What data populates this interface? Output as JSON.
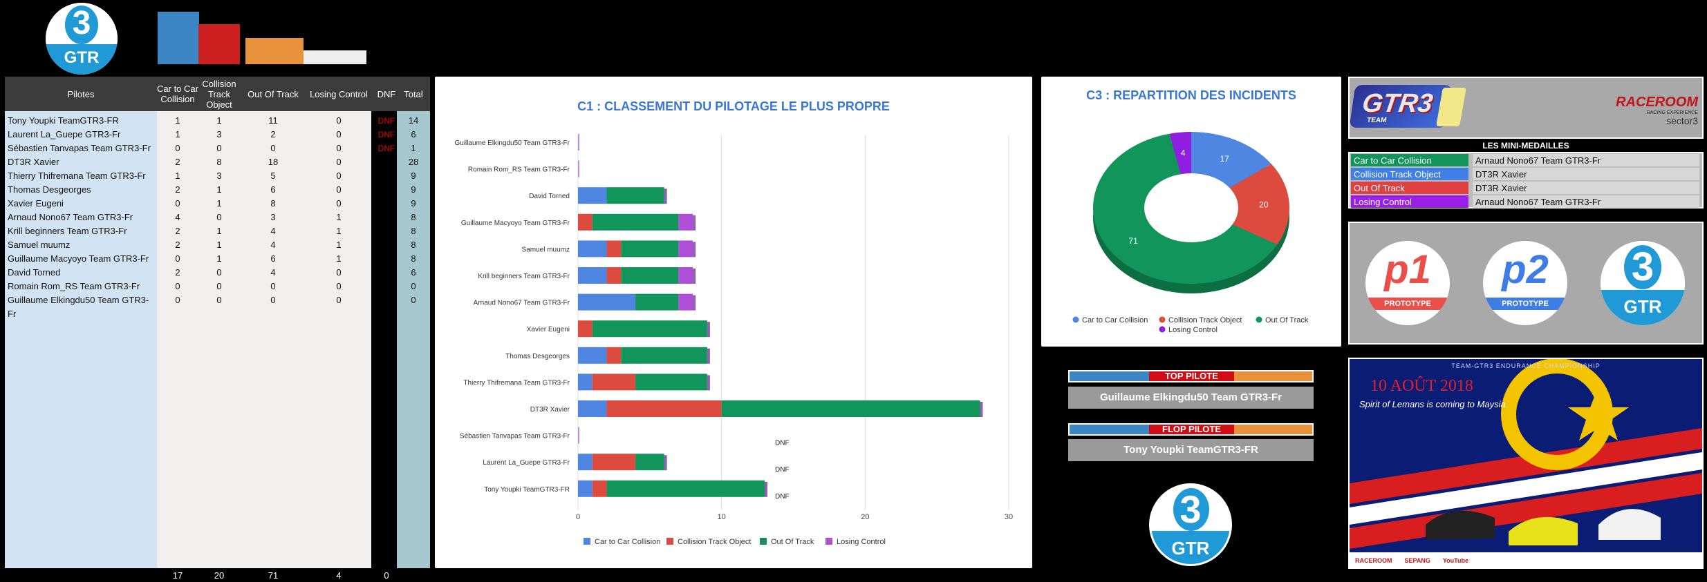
{
  "header": {
    "logo_number": "3",
    "logo_text": "GTR",
    "color_bars": [
      "#3d86c6",
      "#cc1f1f",
      "#e8923c",
      "#efefef"
    ]
  },
  "table": {
    "headers": [
      "Pilotes",
      "Car to Car Collision",
      "Collision Track Object",
      "Out Of Track",
      "Losing Control",
      "DNF",
      "Total"
    ],
    "rows": [
      {
        "name": "Tony Youpki TeamGTR3-FR",
        "c2c": "1",
        "cto": "1",
        "oot": "11",
        "lc": "0",
        "dnf": "DNF",
        "total": "14"
      },
      {
        "name": "Laurent La_Guepe GTR3-Fr",
        "c2c": "1",
        "cto": "3",
        "oot": "2",
        "lc": "0",
        "dnf": "DNF",
        "total": "6"
      },
      {
        "name": "Sébastien Tanvapas Team GTR3-Fr",
        "c2c": "0",
        "cto": "0",
        "oot": "0",
        "lc": "0",
        "dnf": "DNF",
        "total": "1"
      },
      {
        "name": "DT3R Xavier",
        "c2c": "2",
        "cto": "8",
        "oot": "18",
        "lc": "0",
        "dnf": "",
        "total": "28"
      },
      {
        "name": "Thierry Thifremana Team GTR3-Fr",
        "c2c": "1",
        "cto": "3",
        "oot": "5",
        "lc": "0",
        "dnf": "",
        "total": "9"
      },
      {
        "name": "Thomas Desgeorges",
        "c2c": "2",
        "cto": "1",
        "oot": "6",
        "lc": "0",
        "dnf": "",
        "total": "9"
      },
      {
        "name": "Xavier Eugeni",
        "c2c": "0",
        "cto": "1",
        "oot": "8",
        "lc": "0",
        "dnf": "",
        "total": "9"
      },
      {
        "name": "Arnaud Nono67 Team GTR3-Fr",
        "c2c": "4",
        "cto": "0",
        "oot": "3",
        "lc": "1",
        "dnf": "",
        "total": "8"
      },
      {
        "name": "Krill beginners Team GTR3-Fr",
        "c2c": "2",
        "cto": "1",
        "oot": "4",
        "lc": "1",
        "dnf": "",
        "total": "8"
      },
      {
        "name": "Samuel muumz",
        "c2c": "2",
        "cto": "1",
        "oot": "4",
        "lc": "1",
        "dnf": "",
        "total": "8"
      },
      {
        "name": "Guillaume Macyoyo Team GTR3-Fr",
        "c2c": "0",
        "cto": "1",
        "oot": "6",
        "lc": "1",
        "dnf": "",
        "total": "8"
      },
      {
        "name": "David Torned",
        "c2c": "2",
        "cto": "0",
        "oot": "4",
        "lc": "0",
        "dnf": "",
        "total": "6"
      },
      {
        "name": "Romain Rom_RS Team GTR3-Fr",
        "c2c": "0",
        "cto": "0",
        "oot": "0",
        "lc": "0",
        "dnf": "",
        "total": "0"
      },
      {
        "name": "Guillaume Elkingdu50 Team GTR3-Fr",
        "c2c": "0",
        "cto": "0",
        "oot": "0",
        "lc": "0",
        "dnf": "",
        "total": "0"
      }
    ],
    "totals": {
      "c2c": "17",
      "cto": "20",
      "oot": "71",
      "lc": "4",
      "dnf": "0"
    }
  },
  "chart_data": [
    {
      "type": "bar",
      "orientation": "horizontal",
      "stacked": true,
      "title": "C1 : CLASSEMENT DU PILOTAGE LE PLUS PROPRE",
      "categories": [
        "Guillaume Elkingdu50 Team GTR3-Fr",
        "Romain Rom_RS Team GTR3-Fr",
        "David Torned",
        "Guillaume Macyoyo Team GTR3-Fr",
        "Samuel muumz",
        "Krill beginners Team GTR3-Fr",
        "Arnaud Nono67 Team GTR3-Fr",
        "Xavier Eugeni",
        "Thomas Desgeorges",
        "Thierry Thifremana Team GTR3-Fr",
        "DT3R Xavier",
        "Sébastien Tanvapas Team GTR3-Fr",
        "Laurent La_Guepe GTR3-Fr",
        "Tony Youpki TeamGTR3-FR"
      ],
      "series": [
        {
          "name": "Car to Car Collision",
          "color": "#4e86e2",
          "values": [
            0,
            0,
            2,
            0,
            2,
            2,
            4,
            0,
            2,
            1,
            2,
            0,
            1,
            1
          ]
        },
        {
          "name": "Collision Track Object",
          "color": "#dd4b3e",
          "values": [
            0,
            0,
            0,
            1,
            1,
            1,
            0,
            1,
            1,
            3,
            8,
            0,
            3,
            1
          ]
        },
        {
          "name": "Out Of Track",
          "color": "#11955a",
          "values": [
            0,
            0,
            4,
            6,
            4,
            4,
            3,
            8,
            6,
            5,
            18,
            0,
            2,
            11
          ]
        },
        {
          "name": "Losing Control",
          "color": "#ad4fd7",
          "values": [
            0,
            0,
            0,
            1,
            1,
            1,
            1,
            0,
            0,
            0,
            0,
            0,
            0,
            0
          ]
        }
      ],
      "annotations": [
        "",
        "",
        "",
        "",
        "",
        "",
        "",
        "",
        "",
        "",
        "",
        "DNF",
        "DNF",
        "DNF"
      ],
      "xlim": [
        0,
        30
      ],
      "xticks": [
        "0",
        "10",
        "20",
        "30"
      ],
      "grid": true,
      "legend": "bottom"
    },
    {
      "type": "pie",
      "donut": true,
      "title": "C3 : REPARTITION DES INCIDENTS",
      "labels": [
        "Car to Car Collision",
        "Collision Track Object",
        "Out Of Track",
        "Losing Control"
      ],
      "values": [
        17,
        20,
        71,
        4
      ],
      "colors": [
        "#4e86e2",
        "#dd4b3e",
        "#11955a",
        "#8f1ee0"
      ],
      "legend": "bottom"
    }
  ],
  "medals": {
    "title": "LES MINI-MEDAILLES",
    "rows": [
      {
        "label": "Car to Car Collision",
        "value": "Arnaud Nono67 Team GTR3-Fr",
        "color": "#12955a"
      },
      {
        "label": "Collision Track Object",
        "value": "DT3R Xavier",
        "color": "#3f7fe6"
      },
      {
        "label": "Out Of Track",
        "value": "DT3R Xavier",
        "color": "#e04040"
      },
      {
        "label": "Losing Control",
        "value": "Arnaud Nono67 Team GTR3-Fr",
        "color": "#9a1fe6"
      }
    ]
  },
  "banner_gtr3": {
    "logo_text": "GTR3",
    "sub": "TEAM",
    "partner": "RACEROOM",
    "partner_sub": "RACING EXPERIENCE",
    "sponsor": "sector3"
  },
  "classes": [
    {
      "label": "p1",
      "sub": "PROTOTYPE"
    },
    {
      "label": "p2",
      "sub": "PROTOTYPE"
    },
    {
      "label": "3",
      "sub": "GTR"
    }
  ],
  "top_pilote": {
    "label": "TOP PILOTE",
    "name": "Guillaume Elkingdu50 Team GTR3-Fr"
  },
  "flop_pilote": {
    "label": "FLOP PILOTE",
    "name": "Tony Youpki TeamGTR3-FR"
  },
  "poster": {
    "headline": "TEAM-GTR3   ENDURANCE   CHAMPIONSHIP",
    "date": "10 AOÛT 2018",
    "tagline": "Spirit of Lemans is coming to Maysia",
    "footer": [
      "RACEROOM",
      "SEPANG",
      "YouTube"
    ]
  }
}
